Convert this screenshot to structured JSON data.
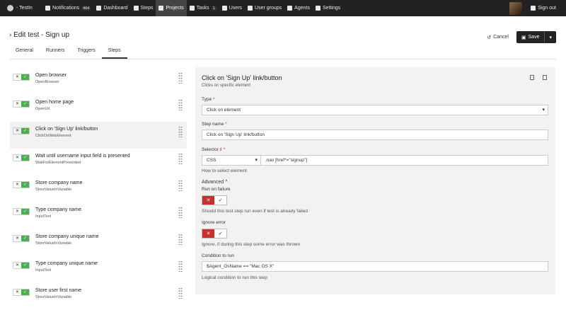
{
  "nav": {
    "brand": "- TestIn",
    "items": [
      {
        "label": "Notifications",
        "badge": "464"
      },
      {
        "label": "Dashboard"
      },
      {
        "label": "Steps"
      },
      {
        "label": "Projects"
      },
      {
        "label": "Tasks",
        "badge": "1"
      },
      {
        "label": "Users"
      },
      {
        "label": "User groups"
      },
      {
        "label": "Agents"
      },
      {
        "label": "Settings"
      }
    ],
    "signout": "Sign out"
  },
  "page": {
    "title": "Edit test - Sign up",
    "cancel_label": "Cancel",
    "save_label": "Save"
  },
  "tabs": [
    "General",
    "Runners",
    "Triggers",
    "Steps"
  ],
  "steps": [
    {
      "name": "Open browser",
      "type": "OpenBrowser"
    },
    {
      "name": "Open home page",
      "type": "OpenUrl"
    },
    {
      "name": "Click on 'Sign Up' link/button",
      "type": "ClickOnWebElement"
    },
    {
      "name": "Wait until username input field is presented",
      "type": "WaitForElementPresented"
    },
    {
      "name": "Store company name",
      "type": "StoreValueInVariable"
    },
    {
      "name": "Type company name",
      "type": "InputText"
    },
    {
      "name": "Store company unique name",
      "type": "StoreValueInVariable"
    },
    {
      "name": "Type company unique name",
      "type": "InputText"
    },
    {
      "name": "Store user first name",
      "type": "StoreValueInVariable"
    }
  ],
  "detail": {
    "title": "Click on 'Sign Up' link/button",
    "subtitle": "Clicks on specific element",
    "type_label": "Type",
    "type_value": "Click on element",
    "stepname_label": "Step name",
    "stepname_value": "Click on 'Sign Up' link/button",
    "selector_label": "Selector",
    "selector_type": "CSS",
    "selector_value": ".nav [href*=\"signup\"]",
    "selector_help": "How to select element",
    "advanced_label": "Advanced",
    "run_on_failure_label": "Run on failure",
    "run_on_failure_help": "Should this test step run even if test is already failed",
    "ignore_error_label": "Ignore error",
    "ignore_error_help": "Ignore, if during this step some error was thrown",
    "condition_label": "Condition to run",
    "condition_value": "$Agent_OsName == \"Mac OS X\"",
    "condition_help": "Logical condition to run this step"
  },
  "colors": {
    "accent_green": "#4cae4c",
    "danger_red": "#c9302c",
    "nav_bg": "#222222"
  }
}
